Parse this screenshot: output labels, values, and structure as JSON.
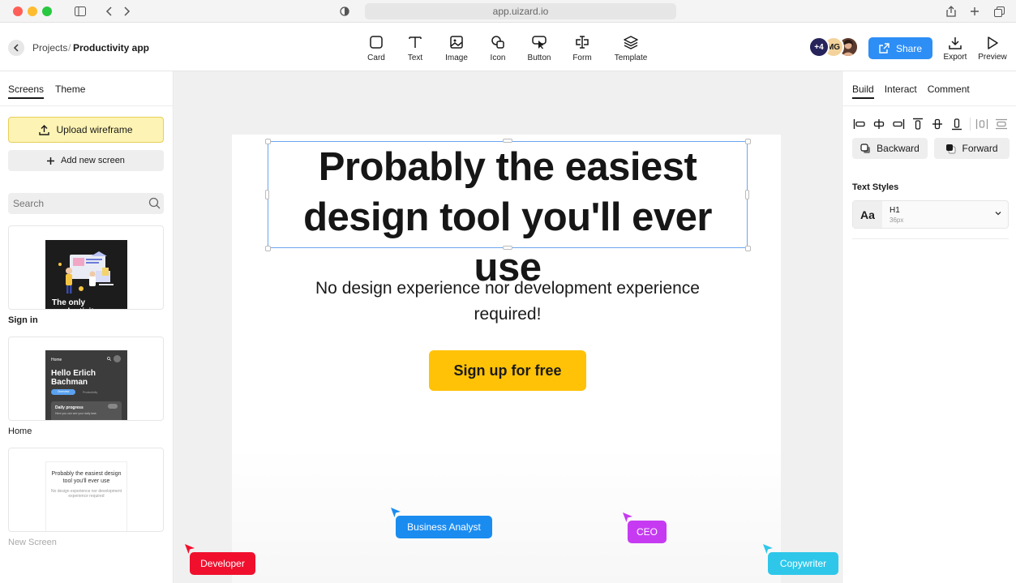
{
  "browser": {
    "url": "app.uizard.io"
  },
  "breadcrumb": {
    "root": "Projects",
    "separator": "/",
    "current": "Productivity app"
  },
  "toolbar": {
    "tools": [
      "Card",
      "Text",
      "Image",
      "Icon",
      "Button",
      "Form",
      "Template"
    ],
    "collaborators": {
      "more": "+4",
      "initials": "MG"
    },
    "share_label": "Share",
    "export_label": "Export",
    "preview_label": "Preview"
  },
  "left_panel": {
    "tabs": [
      "Screens",
      "Theme"
    ],
    "upload_label": "Upload wireframe",
    "add_screen_label": "Add new screen",
    "search_placeholder": "Search",
    "screens": [
      {
        "label": "Sign in",
        "thumb_text": "The only productivity"
      },
      {
        "label": "Home",
        "thumb_title": "Home",
        "thumb_greeting": "Hello Erlich Bachman",
        "thumb_pill": "Overview",
        "thumb_link": "Productivity",
        "thumb_card_title": "Daily progress",
        "thumb_card_sub": "Here you can see your daily task"
      },
      {
        "label": "New Screen",
        "thumb_title": "Probably the easiest design tool you'll ever use",
        "thumb_sub": "No design experience nor development experience required"
      }
    ]
  },
  "canvas": {
    "headline": "Probably the easiest design tool you'll ever use",
    "subheadline": "No design experience nor development experience required!",
    "cta_label": "Sign up for free",
    "cursors": [
      {
        "name": "Business Analyst",
        "color": "#1a8cf0"
      },
      {
        "name": "CEO",
        "color": "#c63bf2"
      },
      {
        "name": "Developer",
        "color": "#f0102e"
      },
      {
        "name": "Copywriter",
        "color": "#2ec7ea"
      }
    ]
  },
  "right_panel": {
    "tabs": [
      "Build",
      "Interact",
      "Comment"
    ],
    "backward_label": "Backward",
    "forward_label": "Forward",
    "text_styles_title": "Text Styles",
    "style_preview": "Aa",
    "style_name": "H1",
    "style_size": "36px"
  },
  "colors": {
    "accent": "#2d8ef5",
    "cta": "#ffc207",
    "upload_bg": "#fdf3b4"
  }
}
